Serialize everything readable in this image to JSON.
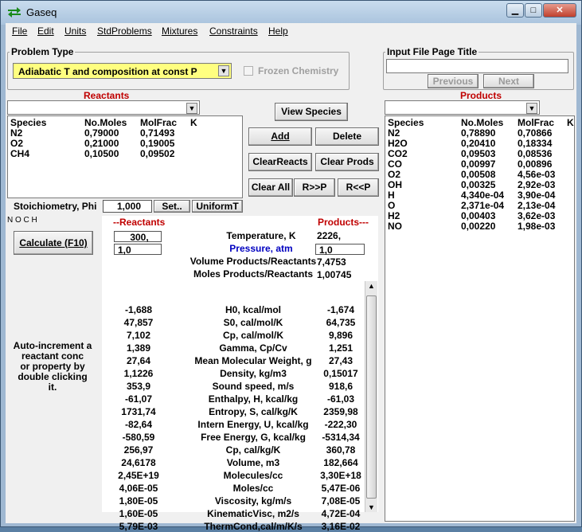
{
  "window": {
    "title": "Gaseq"
  },
  "menu": [
    "File",
    "Edit",
    "Units",
    "StdProblems",
    "Mixtures",
    "Constraints",
    "Help"
  ],
  "problem": {
    "legend": "Problem Type",
    "selected": "Adiabatic T and composition at const P",
    "frozen_label": "Frozen Chemistry"
  },
  "input_page": {
    "legend": "Input File Page Title",
    "title_value": "",
    "previous": "Previous",
    "next": "Next"
  },
  "reactants": {
    "header": "Reactants",
    "columns": [
      "Species",
      "No.Moles",
      "MolFrac",
      "K"
    ],
    "rows": [
      [
        "N2",
        "0,79000",
        "0,71493"
      ],
      [
        "O2",
        "0,21000",
        "0,19005"
      ],
      [
        "CH4",
        "0,10500",
        "0,09502"
      ]
    ],
    "stoich_label": "Stoichiometry, Phi",
    "stoich_value": "1,000",
    "set_label": "Set..",
    "uniform_label": "UniformT"
  },
  "buttons": {
    "view_species": "View Species",
    "add": "Add",
    "delete": "Delete",
    "clear_reacts": "ClearReacts",
    "clear_prods": "Clear Prods",
    "clear_all": "Clear All",
    "r_to_p": "R>>P",
    "r_from_p": "R<<P",
    "calculate": "Calculate (F10)"
  },
  "noch": "N O C H",
  "auto_text": [
    "Auto-increment a",
    "reactant conc",
    "or property by",
    "double clicking",
    "it."
  ],
  "products": {
    "header": "Products",
    "columns": [
      "Species",
      "No.Moles",
      "MolFrac",
      "K"
    ],
    "rows": [
      [
        "N2",
        "0,78890",
        "0,70866"
      ],
      [
        "H2O",
        "0,20410",
        "0,18334"
      ],
      [
        "CO2",
        "0,09503",
        "0,08536"
      ],
      [
        "CO",
        "0,00997",
        "0,00896"
      ],
      [
        "O2",
        "0,00508",
        "4,56e-03"
      ],
      [
        "OH",
        "0,00325",
        "2,92e-03"
      ],
      [
        "H",
        "4,340e-04",
        "3,90e-04"
      ],
      [
        "O",
        "2,371e-04",
        "2,13e-04"
      ],
      [
        "H2",
        "0,00403",
        "3,62e-03"
      ],
      [
        "NO",
        "0,00220",
        "1,98e-03"
      ]
    ]
  },
  "results": {
    "reactants_header": "--Reactants",
    "products_header": "Products---",
    "temperature": {
      "label": "Temperature, K",
      "react": "300,",
      "prod": "2226,"
    },
    "pressure": {
      "label": "Pressure, atm",
      "react": "1,0",
      "prod": "1,0"
    },
    "vol_ratio": {
      "label": "Volume Products/Reactants",
      "prod": "7,4753"
    },
    "mole_ratio": {
      "label": "Moles Products/Reactants",
      "prod": "1,00745"
    },
    "props": [
      [
        "-1,688",
        "H0,  kcal/mol",
        "-1,674"
      ],
      [
        "47,857",
        "S0,  cal/mol/K",
        "64,735"
      ],
      [
        "7,102",
        "Cp,  cal/mol/K",
        "9,896"
      ],
      [
        "1,389",
        "Gamma, Cp/Cv",
        "1,251"
      ],
      [
        "27,64",
        "Mean Molecular Weight, g",
        "27,43"
      ],
      [
        "1,1226",
        "Density,  kg/m3",
        "0,15017"
      ],
      [
        "353,9",
        "Sound speed,  m/s",
        "918,6"
      ],
      [
        "-61,07",
        "Enthalpy, H,  kcal/kg",
        "-61,03"
      ],
      [
        "1731,74",
        "Entropy,  S,  cal/kg/K",
        "2359,98"
      ],
      [
        "-82,64",
        "Intern Energy, U,  kcal/kg",
        "-222,30"
      ],
      [
        "-580,59",
        "Free Energy, G, kcal/kg",
        "-5314,34"
      ],
      [
        "256,97",
        "Cp, cal/kg/K",
        "360,78"
      ],
      [
        "24,6178",
        "Volume,  m3",
        "182,664"
      ],
      [
        "2,45E+19",
        "Molecules/cc",
        "3,30E+18"
      ],
      [
        "4,06E-05",
        "Moles/cc",
        "5,47E-06"
      ],
      [
        "1,80E-05",
        "Viscosity,  kg/m/s",
        "7,08E-05"
      ],
      [
        "1,60E-05",
        "KinematicVisc,  m2/s",
        "4,72E-04"
      ],
      [
        "5,79E-03",
        "ThermCond,cal/m/K/s",
        "3,16E-02"
      ]
    ]
  },
  "colors": {
    "combo_yellow": "#ffff80",
    "header_red": "#c00000",
    "pressure_blue": "#0000c0"
  }
}
